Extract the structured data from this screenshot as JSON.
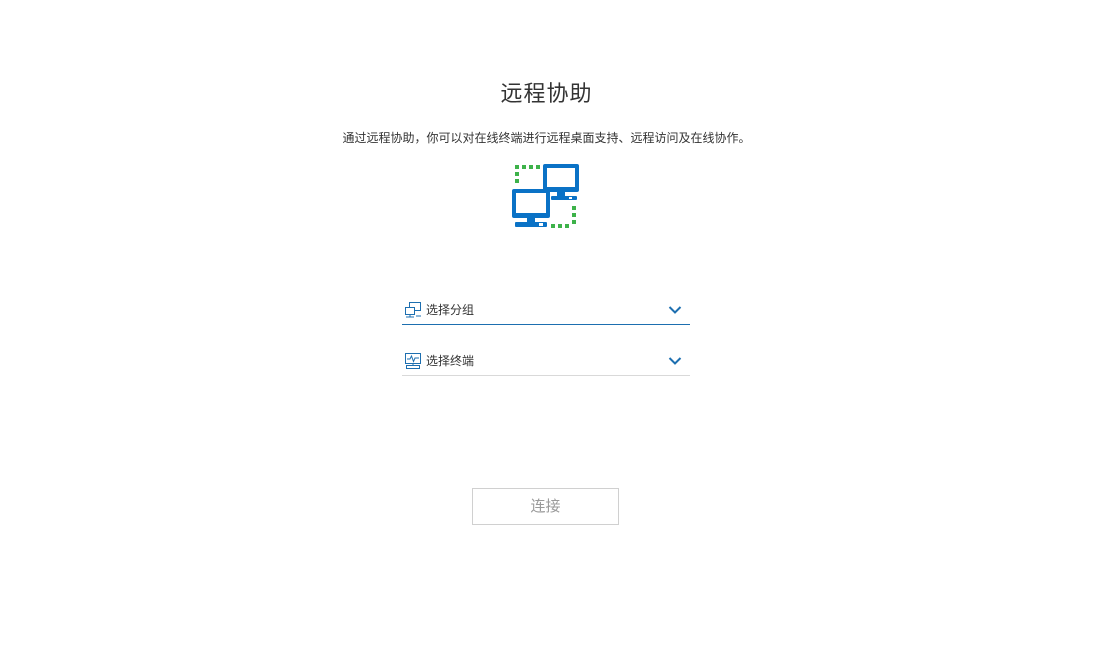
{
  "page": {
    "title": "远程协助",
    "description": "通过远程协助，你可以对在线终端进行远程桌面支持、远程访问及在线协作。"
  },
  "hero": {
    "icon": "remote-computers-icon",
    "colors": {
      "monitor": "#0a72c6",
      "link": "#3db24a"
    }
  },
  "form": {
    "group_select": {
      "placeholder": "选择分组",
      "icon": "group-icon",
      "active": true
    },
    "terminal_select": {
      "placeholder": "选择终端",
      "icon": "terminal-icon",
      "active": false
    }
  },
  "actions": {
    "connect_label": "连接",
    "connect_enabled": false
  },
  "colors": {
    "accent": "#1d6fb0",
    "text": "#333333",
    "disabled_text": "#9a9a9a",
    "border_light": "#d9d9d9"
  }
}
